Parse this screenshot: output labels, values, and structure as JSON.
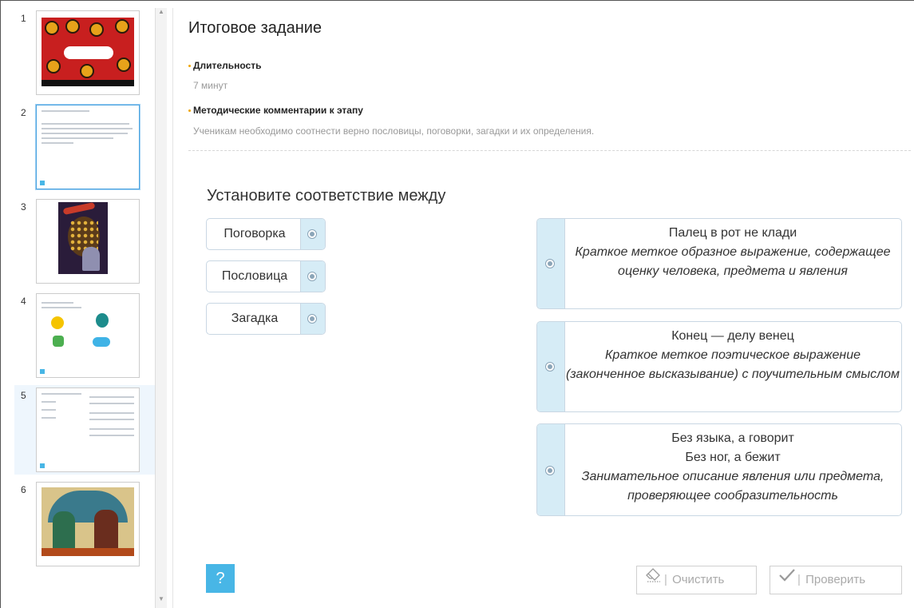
{
  "sidebar": {
    "slides": [
      {
        "number": "1"
      },
      {
        "number": "2"
      },
      {
        "number": "3"
      },
      {
        "number": "4"
      },
      {
        "number": "5"
      },
      {
        "number": "6"
      }
    ],
    "active_slide": "5",
    "selected_thumb": "2"
  },
  "stage": {
    "title": "Итоговое задание",
    "duration_label": "Длительность",
    "duration_value": "7 минут",
    "comments_label": "Методические комментарии к этапу",
    "comments_value": "Ученикам необходимо соотнести верно пословицы, поговорки, загадки и их определения."
  },
  "task": {
    "instruction": "Установите соответствие между",
    "left_items": [
      "Поговорка",
      "Пословица",
      "Загадка"
    ],
    "right_items": [
      {
        "lines": [
          "Палец в рот не клади"
        ],
        "definition": "Краткое меткое образное выражение, содержащее оценку человека, предмета и явления"
      },
      {
        "lines": [
          "Конец — делу венец"
        ],
        "definition": "Краткое меткое поэтическое выражение (законченное высказывание) с поучительным смыслом"
      },
      {
        "lines": [
          "Без языка, а говорит",
          "Без ног, а бежит"
        ],
        "definition": "Занимательное описание явления или предмета, проверяющее сообразительность"
      }
    ]
  },
  "controls": {
    "help_label": "?",
    "clear_label": "Очистить",
    "check_label": "Проверить"
  },
  "colors": {
    "accent_blue": "#48b6e6",
    "handle_bg": "#d6ecf6",
    "bullet": "#f0a500",
    "selection_bg": "#eef6fd"
  },
  "icons": {
    "eraser": "eraser-icon",
    "check": "checkmark-icon",
    "radio": "radio-icon"
  }
}
